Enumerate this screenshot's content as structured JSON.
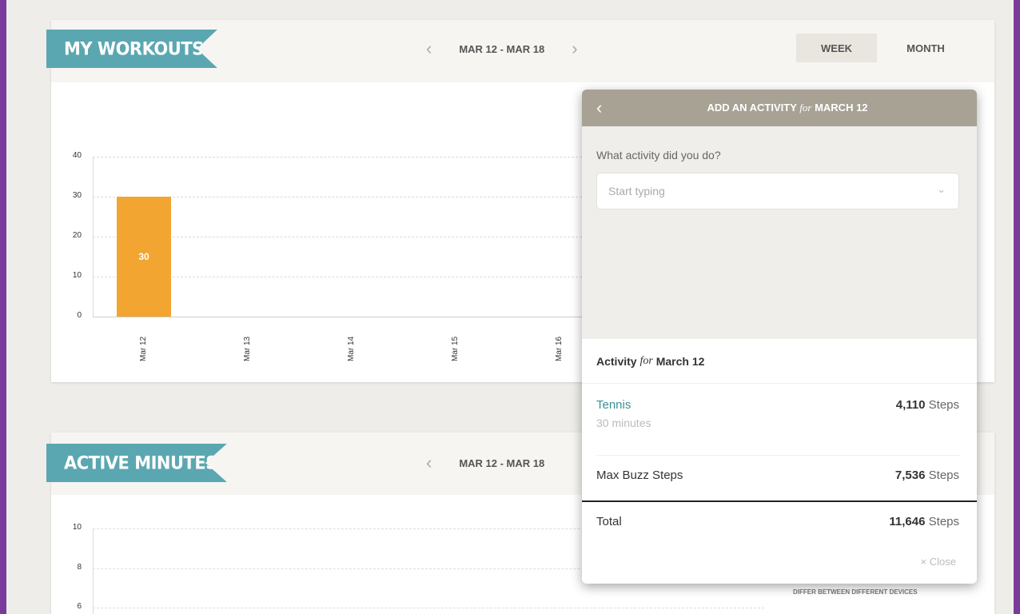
{
  "workouts": {
    "title": "MY WORKOUTS",
    "date_range": "MAR 12 - MAR 18",
    "prev_icon": "chevron-left-icon",
    "next_icon": "chevron-right-icon",
    "toggle": {
      "week": "WEEK",
      "month": "MONTH",
      "active": "WEEK"
    },
    "chart_data": {
      "type": "bar",
      "categories": [
        "Mar 12",
        "Mar 13",
        "Mar 14",
        "Mar 15",
        "Mar 16"
      ],
      "values": [
        30,
        0,
        0,
        0,
        0
      ],
      "data_labels": [
        "30",
        "",
        "",
        "",
        ""
      ],
      "ylim": [
        0,
        40
      ],
      "yticks": [
        "0",
        "10",
        "20",
        "30",
        "40"
      ],
      "title": "",
      "xlabel": "",
      "ylabel": "",
      "bar_color": "#f2a531",
      "grid": true
    }
  },
  "active_minutes": {
    "title": "ACTIVE MINUTES",
    "date_range": "MAR 12 - MAR 18",
    "yticks": [
      "10",
      "8",
      "6"
    ],
    "footnote": "DIFFER BETWEEN DIFFERENT DEVICES"
  },
  "modal": {
    "title_a": "ADD AN ACTIVITY",
    "title_for": "for",
    "title_b": "MARCH 12",
    "question": "What activity did you do?",
    "input_placeholder": "Start typing",
    "activity_label": "Activity",
    "activity_for": "for",
    "activity_date": "March 12",
    "rows": [
      {
        "name": "Tennis",
        "sub": "30 minutes",
        "value": "4,110",
        "unit": "Steps"
      },
      {
        "name": "Max Buzz Steps",
        "value": "7,536",
        "unit": "Steps"
      }
    ],
    "total": {
      "name": "Total",
      "value": "11,646",
      "unit": "Steps"
    },
    "close_label": "× Close"
  },
  "colors": {
    "accent_teal": "#5ba7b1",
    "bar_orange": "#f2a531",
    "frame_purple": "#7a3c9a",
    "modal_header": "#a7a294",
    "link_teal": "#3c8f98"
  }
}
